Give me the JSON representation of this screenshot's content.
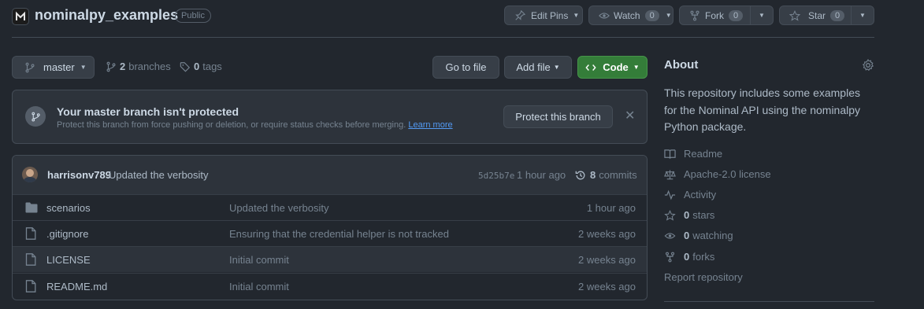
{
  "repo": {
    "name": "nominalpy_examples",
    "visibility": "Public"
  },
  "header": {
    "edit_pins": "Edit Pins",
    "watch_label": "Watch",
    "watch_count": "0",
    "fork_label": "Fork",
    "fork_count": "0",
    "star_label": "Star",
    "star_count": "0"
  },
  "toolbar": {
    "branch": "master",
    "branches_count": "2",
    "branches_label": "branches",
    "tags_count": "0",
    "tags_label": "tags",
    "go_to_file": "Go to file",
    "add_file": "Add file",
    "code": "Code"
  },
  "protect": {
    "title": "Your master branch isn't protected",
    "desc": "Protect this branch from force pushing or deletion, or require status checks before merging.",
    "learn_more": "Learn more",
    "button": "Protect this branch"
  },
  "commit": {
    "author": "harrisonv789",
    "message": "Updated the verbosity",
    "sha": "5d25b7e",
    "time": "1 hour ago",
    "commits_count": "8",
    "commits_label": "commits"
  },
  "files": [
    {
      "type": "folder",
      "name": "scenarios",
      "message": "Updated the verbosity",
      "time": "1 hour ago"
    },
    {
      "type": "file",
      "name": ".gitignore",
      "message": "Ensuring that the credential helper is not tracked",
      "time": "2 weeks ago"
    },
    {
      "type": "file",
      "name": "LICENSE",
      "message": "Initial commit",
      "time": "2 weeks ago"
    },
    {
      "type": "file",
      "name": "README.md",
      "message": "Initial commit",
      "time": "2 weeks ago"
    }
  ],
  "about": {
    "heading": "About",
    "description": "This repository includes some examples for the Nominal API using the nominalpy Python package.",
    "readme": "Readme",
    "license": "Apache-2.0 license",
    "activity": "Activity",
    "stars_count": "0",
    "stars_label": "stars",
    "watching_count": "0",
    "watching_label": "watching",
    "forks_count": "0",
    "forks_label": "forks",
    "report": "Report repository"
  },
  "colors": {
    "bg": "#22272e",
    "accent_green": "#347d39",
    "link": "#539bf5"
  }
}
